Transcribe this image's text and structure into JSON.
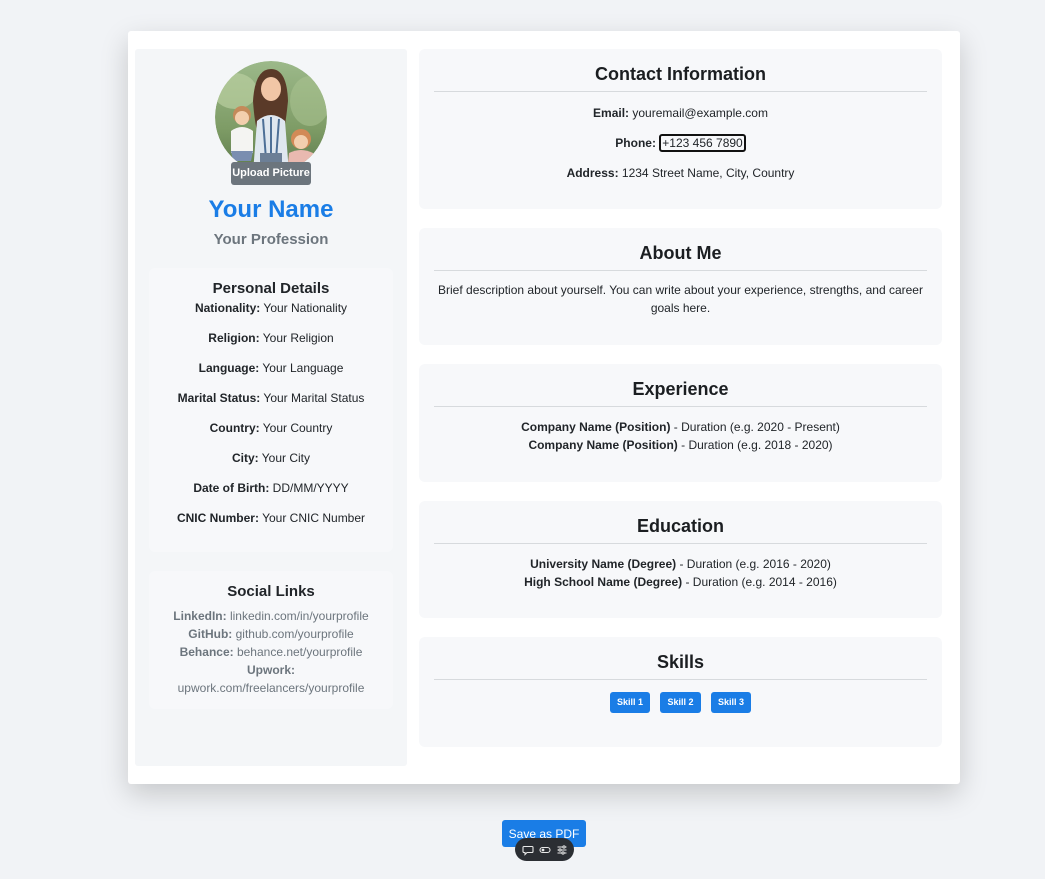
{
  "profile": {
    "upload_label": "Upload Picture",
    "name": "Your Name",
    "profession": "Your Profession"
  },
  "personal": {
    "title": "Personal Details",
    "rows": [
      {
        "label": "Nationality:",
        "value": " Your Nationality"
      },
      {
        "label": "Religion:",
        "value": " Your Religion"
      },
      {
        "label": "Language:",
        "value": " Your Language"
      },
      {
        "label": "Marital Status:",
        "value": " Your Marital Status"
      },
      {
        "label": "Country:",
        "value": " Your Country"
      },
      {
        "label": "City:",
        "value": " Your City"
      },
      {
        "label": "Date of Birth:",
        "value": " DD/MM/YYYY"
      },
      {
        "label": "CNIC Number:",
        "value": " Your CNIC Number"
      }
    ]
  },
  "social": {
    "title": "Social Links",
    "linkedin_label": "LinkedIn:",
    "linkedin_value": " linkedin.com/in/yourprofile",
    "github_label": "GitHub:",
    "github_value": " github.com/yourprofile",
    "behance_label": "Behance:",
    "behance_value": " behance.net/yourprofile",
    "upwork_label": "Upwork:",
    "upwork_value": "upwork.com/freelancers/yourprofile"
  },
  "contact": {
    "title": "Contact Information",
    "email_label": "Email:",
    "email_value": " youremail@example.com",
    "phone_label": "Phone:",
    "phone_value": "+123 456 7890",
    "address_label": "Address:",
    "address_value": " 1234 Street Name, City, Country"
  },
  "about": {
    "title": "About Me",
    "text": "Brief description about yourself. You can write about your experience, strengths, and career goals here."
  },
  "experience": {
    "title": "Experience",
    "items": [
      {
        "bold": "Company Name (Position)",
        "rest": " - Duration (e.g. 2020 - Present)"
      },
      {
        "bold": "Company Name (Position)",
        "rest": " - Duration (e.g. 2018 - 2020)"
      }
    ]
  },
  "education": {
    "title": "Education",
    "items": [
      {
        "bold": "University Name (Degree)",
        "rest": " - Duration (e.g. 2016 - 2020)"
      },
      {
        "bold": "High School Name (Degree)",
        "rest": " - Duration (e.g. 2014 - 2016)"
      }
    ]
  },
  "skills": {
    "title": "Skills",
    "items": [
      "Skill 1",
      "Skill 2",
      "Skill 3"
    ]
  },
  "actions": {
    "save_pdf": "Save as PDF"
  },
  "toolbar": {
    "icons": [
      "comment-icon",
      "toggle-icon",
      "settings-icon"
    ]
  },
  "colors": {
    "accent": "#1a7de6",
    "muted": "#6c757d",
    "page_bg": "#f1f3f6"
  }
}
